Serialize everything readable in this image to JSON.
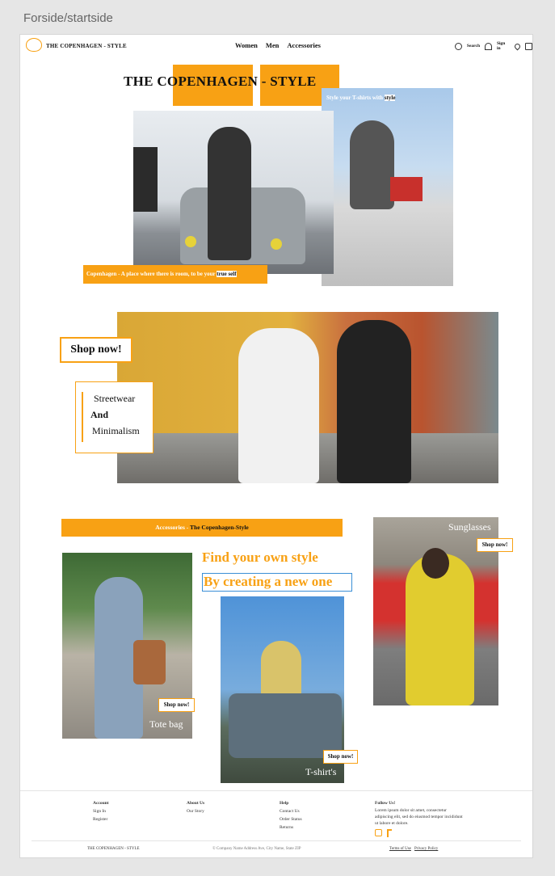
{
  "frame": {
    "label": "Forside/startside"
  },
  "nav": {
    "brand": "THE COPENHAGEN - STYLE",
    "links": [
      "Women",
      "Men",
      "Accessories"
    ],
    "search_label": "Search",
    "signin_label": "Sign in"
  },
  "hero": {
    "title": "THE COPENHAGEN - STYLE",
    "caption_right_prefix": "Style your T-shirts with",
    "caption_right_bold": "style",
    "tagline_prefix": "Copenhagen - A place where there is room, to be your",
    "tagline_bold": "true self"
  },
  "promo": {
    "shop_now": "Shop now!",
    "lines": [
      "Streetwear",
      "And",
      "Minimalism"
    ]
  },
  "accessories": {
    "banner_prefix": "Accessories -",
    "banner_bold": "The Copenhagen-Style",
    "headline1": "Find your own style",
    "headline2": "By creating a new one",
    "tote_label": "Tote bag",
    "tshirt_label": "T-shirt's",
    "sunglasses_label": "Sunglasses",
    "shop_now": "Shop now!"
  },
  "footer": {
    "col1": {
      "title": "Account",
      "items": [
        "Sign In",
        "Register"
      ]
    },
    "col2": {
      "title": "About Us",
      "items": [
        "Our Story"
      ]
    },
    "col3": {
      "title": "Help",
      "items": [
        "Contact Us",
        "Order Status",
        "Returns"
      ]
    },
    "col4": {
      "title": "Follow Us!",
      "text": "Lorem ipsum dolor sit amet, consectetur adipiscing elit, sed do eiusmod tempor incididunt ut labore et dolore."
    },
    "brand": "THE COPENHAGEN - STYLE",
    "address": "© Company Name Address Ave, City Name, State ZIP",
    "terms": "Terms of Use",
    "privacy": "Privacy Policy"
  },
  "colors": {
    "accent": "#f8a114",
    "accent_blue": "#3a8fd6"
  }
}
